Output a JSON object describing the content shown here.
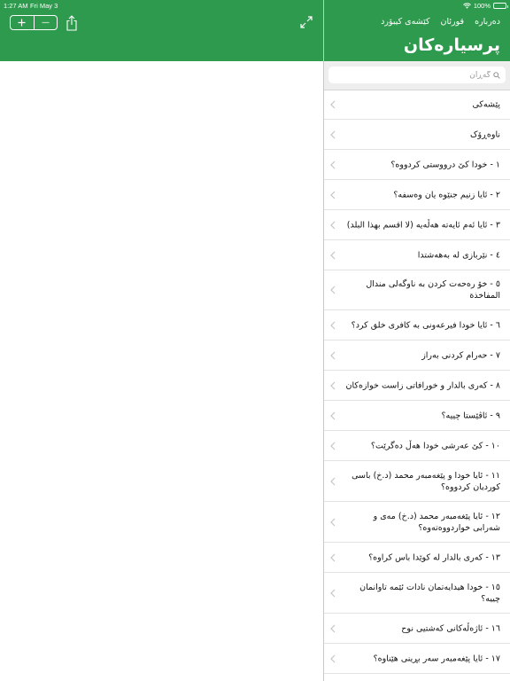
{
  "status_bar": {
    "time": "1:27 AM",
    "date": "Fri May 3",
    "battery_text": "100%",
    "battery_level": 1.0
  },
  "colors": {
    "header_green": "#2e9a4e",
    "search_bg": "#eeeeef",
    "chevron": "#c4c4c6"
  },
  "toolbar": {
    "increase_label": "+",
    "decrease_label": "−",
    "icons": [
      "plus-icon",
      "minus-icon",
      "share-icon",
      "expand-icon"
    ]
  },
  "header": {
    "nav_items": [
      "دەربارە",
      "قورئان",
      "کێشەی کیبۆرد"
    ],
    "title": "پرسیارەکان"
  },
  "search": {
    "placeholder": "گەڕان",
    "icon": "search-icon"
  },
  "list": {
    "items": [
      "پێشەکی",
      "ناوەڕۆک",
      "١ - خودا کێ درووستی کردووە؟",
      "٢ - ئایا زنیم جنێوە یان وەسفە؟",
      "٣ - ئایا ئەم ئایەتە هەڵەیە (لا اقسم بهذا البلد)",
      "٤ - نێربازی لە بەهەشتدا",
      "٥ - خۆ رەحەت کردن بە ناوگەلی مندال المفاخذة",
      "٦ - ئایا خودا فیرعەونی بە کافری خلق کرد؟",
      "٧ - حەرام کردنی بەراز",
      "٨ - کەری بالدار و خورافاتی زاست خوازەکان",
      "٩ - ئاڤێستا چییە؟",
      "١٠ - کێ عەرشی خودا هەڵ دەگرێت؟",
      "١١ - ئایا خودا و پێغەمبەر محمد (د.خ) باسی کوردیان کردووە؟",
      "١٢ - ئایا پێغەمبەر محمد (د.خ) مەی و شەرابی خواردووەتەوە؟",
      "١٣ - کەری بالدار لە کوێدا باس کراوە؟",
      "١٥ - خودا هیدایەتمان نادات ئێمە تاوانمان چییە؟",
      "١٦ - ئاژەڵەکانی کەشتیی نوح",
      "١٧ - ئایا پێغەمبەر سەر بڕینی هێناوە؟"
    ]
  }
}
